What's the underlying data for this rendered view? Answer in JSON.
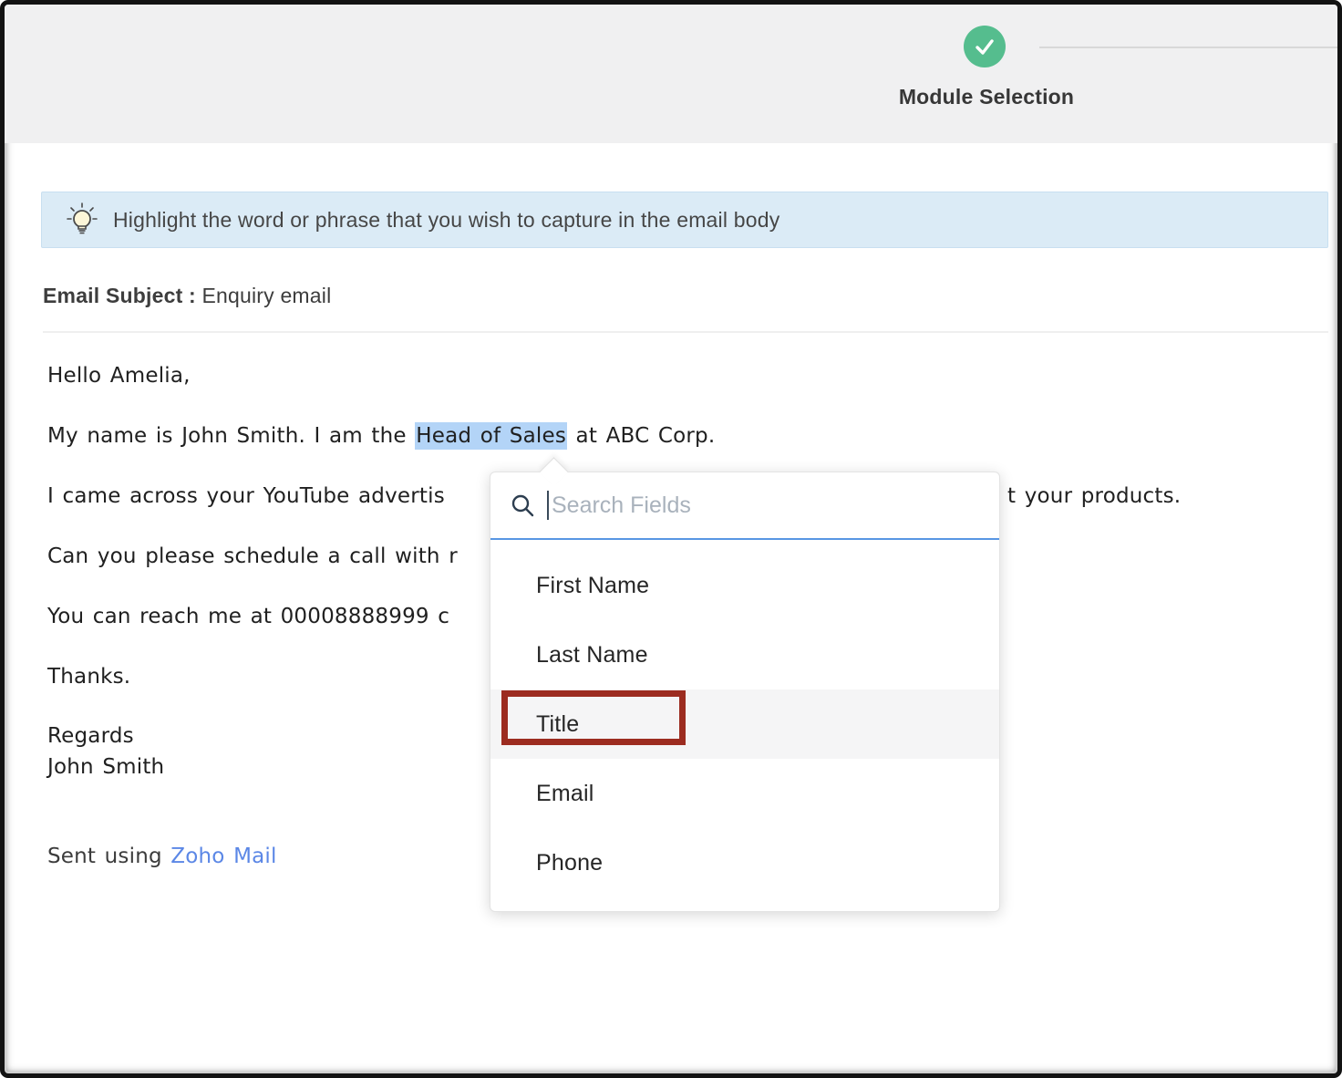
{
  "header": {
    "step_label": "Module Selection",
    "status_icon": "check-circle-icon",
    "accent_green": "#55bd8e"
  },
  "banner": {
    "icon": "lightbulb-icon",
    "text": "Highlight the word or phrase that you wish to capture in the email body",
    "bg_color": "#dbebf6"
  },
  "subject": {
    "label": "Email Subject :",
    "value": "Enquiry email"
  },
  "email_body": {
    "greeting": "Hello Amelia,",
    "line2_before": "My name is John Smith. I am the ",
    "line2_highlight": "Head of Sales",
    "line2_after": " at ABC Corp.",
    "line3_left": "I came across your YouTube advertis",
    "line3_right": "t your products.",
    "line4_left": "Can you please schedule a call with r",
    "line5_left": "You can reach me at 00008888999 c",
    "thanks": "Thanks.",
    "regards": "Regards",
    "signature": "John Smith",
    "footer_prefix": "Sent using ",
    "footer_link": "Zoho Mail",
    "highlight_color": "#b3d4f7",
    "link_color": "#5b87e6"
  },
  "dropdown": {
    "search_icon": "magnifier-icon",
    "search_placeholder": "Search Fields",
    "search_value": "",
    "underline_color": "#5896e3",
    "items": [
      {
        "label": "First Name",
        "selected": false
      },
      {
        "label": "Last Name",
        "selected": false
      },
      {
        "label": "Title",
        "selected": true
      },
      {
        "label": "Email",
        "selected": false
      },
      {
        "label": "Phone",
        "selected": false
      }
    ],
    "annotation_color": "#9c2c20"
  }
}
